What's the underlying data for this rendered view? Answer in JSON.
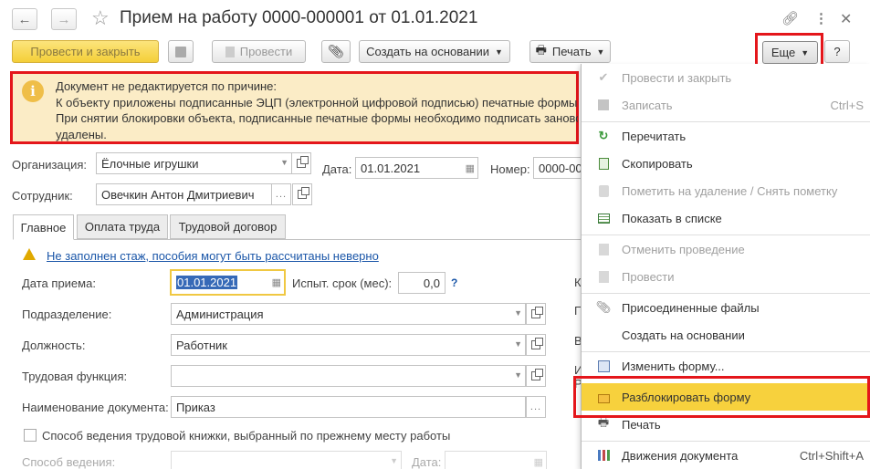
{
  "window": {
    "title": "Прием на работу 0000-000001 от 01.01.2021"
  },
  "toolbar": {
    "post_close": "Провести и закрыть",
    "post": "Провести",
    "create_based": "Создать на основании",
    "print": "Печать",
    "more": "Еще",
    "help": "?"
  },
  "warning": {
    "line1": "Документ не редактируется по причине:",
    "line2": "К объекту приложены подписанные ЭЦП (электронной цифровой подписью) печатные формы.",
    "line3": "При снятии блокировки объекта, подписанные печатные формы необходимо подписать заново",
    "line4": "удалены."
  },
  "header_fields": {
    "org_label": "Организация:",
    "org_value": "Ёлочные игрушки",
    "date_label": "Дата:",
    "date_value": "01.01.2021",
    "number_label": "Номер:",
    "number_value": "0000-00",
    "employee_label": "Сотрудник:",
    "employee_value": "Овечкин Антон Дмитриевич"
  },
  "tabs": [
    "Главное",
    "Оплата труда",
    "Трудовой договор"
  ],
  "main": {
    "experience_link": "Не заполнен стаж, пособия могут быть рассчитаны неверно",
    "hire_date_label": "Дата приема:",
    "hire_date_value": "01.01.2021",
    "probation_label": "Испыт. срок (мес):",
    "probation_value": "0,0",
    "probation_help": "?",
    "division_label": "Подразделение:",
    "division_value": "Администрация",
    "position_label": "Должность:",
    "position_value": "Работник",
    "labor_function_label": "Трудовая функция:",
    "labor_function_value": "",
    "doc_name_label": "Наименование документа:",
    "doc_name_value": "Приказ",
    "workbook_checkbox_label": "Способ ведения трудовой книжки, выбранный по прежнему месту работы",
    "method_label": "Способ ведения:",
    "date2_label": "Дата:",
    "right_cut_letters": [
      "К",
      "П",
      "В",
      "И",
      "Р"
    ]
  },
  "menu": {
    "items": [
      {
        "label": "Провести и закрыть",
        "shortcut": "",
        "disabled": true,
        "icon": "post-close-icon"
      },
      {
        "label": "Записать",
        "shortcut": "Ctrl+S",
        "disabled": true,
        "icon": "save-icon"
      },
      {
        "label": "Перечитать",
        "shortcut": "",
        "disabled": false,
        "icon": "refresh-icon"
      },
      {
        "label": "Скопировать",
        "shortcut": "",
        "disabled": false,
        "icon": "copy-icon"
      },
      {
        "label": "Пометить на удаление / Снять пометку",
        "shortcut": "",
        "disabled": true,
        "icon": "delete-mark-icon"
      },
      {
        "label": "Показать в списке",
        "shortcut": "",
        "disabled": false,
        "icon": "list-icon"
      },
      {
        "label": "Отменить проведение",
        "shortcut": "",
        "disabled": true,
        "icon": "unpost-icon"
      },
      {
        "label": "Провести",
        "shortcut": "",
        "disabled": true,
        "icon": "post-icon"
      },
      {
        "label": "Присоединенные файлы",
        "shortcut": "",
        "disabled": false,
        "icon": "paperclip-icon"
      },
      {
        "label": "Создать на основании",
        "shortcut": "",
        "disabled": false,
        "icon": ""
      },
      {
        "label": "Изменить форму...",
        "shortcut": "",
        "disabled": false,
        "icon": "form-settings-icon"
      },
      {
        "label": "Разблокировать форму",
        "shortcut": "",
        "disabled": false,
        "icon": "unlock-icon"
      },
      {
        "label": "Печать",
        "shortcut": "",
        "disabled": false,
        "icon": "printer-icon"
      },
      {
        "label": "Движения документа",
        "shortcut": "Ctrl+Shift+A",
        "disabled": false,
        "icon": "movements-icon"
      }
    ]
  },
  "colors": {
    "highlight": "#f7d13d",
    "red_frame": "#e4161b",
    "link": "#1a56a8",
    "warning_bg": "#fbecc6"
  }
}
